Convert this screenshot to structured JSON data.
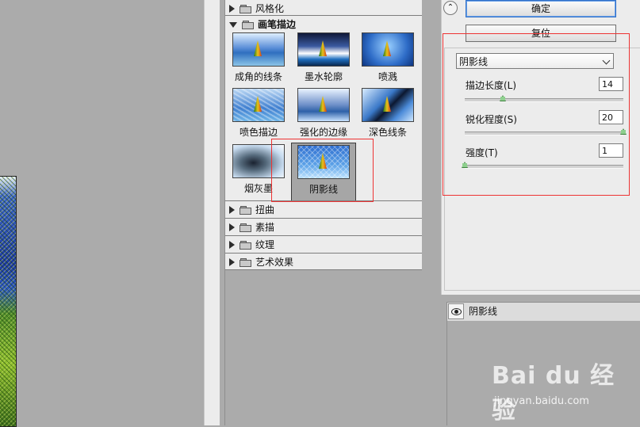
{
  "gallery": {
    "categories_top": [
      {
        "label": "风格化",
        "expanded": false
      }
    ],
    "open_category": {
      "label": "画笔描边",
      "expanded": true
    },
    "filters": [
      {
        "label": "成角的线条",
        "selected": false
      },
      {
        "label": "墨水轮廓",
        "selected": false
      },
      {
        "label": "喷溅",
        "selected": false
      },
      {
        "label": "喷色描边",
        "selected": false
      },
      {
        "label": "强化的边缘",
        "selected": false
      },
      {
        "label": "深色线条",
        "selected": false
      },
      {
        "label": "烟灰墨",
        "selected": false
      },
      {
        "label": "阴影线",
        "selected": true
      }
    ],
    "categories_bottom": [
      {
        "label": "扭曲"
      },
      {
        "label": "素描"
      },
      {
        "label": "纹理"
      },
      {
        "label": "艺术效果"
      }
    ]
  },
  "controls": {
    "ok_label": "确定",
    "reset_label": "复位",
    "filter_select_value": "阴影线",
    "params": [
      {
        "label": "描边长度(L)",
        "value": "14",
        "fraction": 0.24
      },
      {
        "label": "锐化程度(S)",
        "value": "20",
        "fraction": 1.0
      },
      {
        "label": "强度(T)",
        "value": "1",
        "fraction": 0.0
      }
    ]
  },
  "layers": {
    "items": [
      {
        "label": "阴影线",
        "visible": true
      }
    ]
  },
  "watermark": {
    "brand": "Bai du 经验",
    "url": "jingyan.baidu.com"
  },
  "colors": {
    "panel_bg": "#ececec",
    "workspace_bg": "#ababab",
    "highlight_red": "#e33333"
  }
}
